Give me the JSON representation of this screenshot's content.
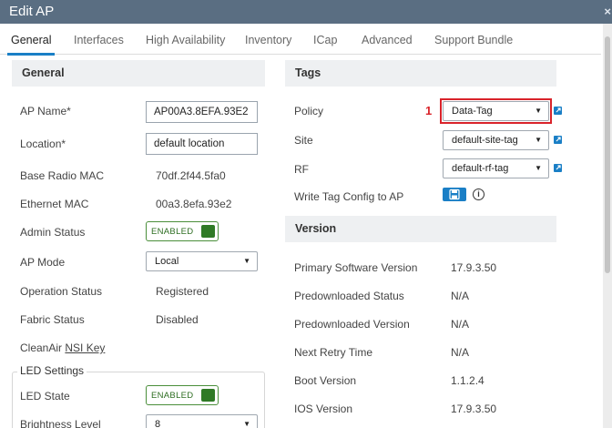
{
  "window": {
    "title": "Edit AP",
    "close_glyph": "×"
  },
  "tabs": [
    {
      "label": "General",
      "active": true
    },
    {
      "label": "Interfaces"
    },
    {
      "label": "High Availability"
    },
    {
      "label": "Inventory"
    },
    {
      "label": "ICap"
    },
    {
      "label": "Advanced"
    },
    {
      "label": "Support Bundle"
    }
  ],
  "general": {
    "heading": "General",
    "ap_name": {
      "label": "AP Name*",
      "value": "AP00A3.8EFA.93E2"
    },
    "location": {
      "label": "Location*",
      "value": "default location"
    },
    "base_radio_mac": {
      "label": "Base Radio MAC",
      "value": "70df.2f44.5fa0"
    },
    "ethernet_mac": {
      "label": "Ethernet MAC",
      "value": "00a3.8efa.93e2"
    },
    "admin_status": {
      "label": "Admin Status",
      "value": "ENABLED"
    },
    "ap_mode": {
      "label": "AP Mode",
      "value": "Local"
    },
    "operation_status": {
      "label": "Operation Status",
      "value": "Registered"
    },
    "fabric_status": {
      "label": "Fabric Status",
      "value": "Disabled"
    },
    "cleanair": {
      "label": "CleanAir",
      "link": "NSI Key"
    }
  },
  "led_settings": {
    "legend": "LED Settings",
    "led_state": {
      "label": "LED State",
      "value": "ENABLED"
    },
    "brightness_level": {
      "label": "Brightness Level",
      "value": "8"
    }
  },
  "tags": {
    "heading": "Tags",
    "policy": {
      "label": "Policy",
      "value": "Data-Tag"
    },
    "site": {
      "label": "Site",
      "value": "default-site-tag"
    },
    "rf": {
      "label": "RF",
      "value": "default-rf-tag"
    },
    "write_tag": {
      "label": "Write Tag Config to AP"
    },
    "callout_number": "1",
    "info_glyph": "i"
  },
  "version": {
    "heading": "Version",
    "rows": [
      {
        "label": "Primary Software Version",
        "value": "17.9.3.50"
      },
      {
        "label": "Predownloaded Status",
        "value": "N/A"
      },
      {
        "label": "Predownloaded Version",
        "value": "N/A"
      },
      {
        "label": "Next Retry Time",
        "value": "N/A"
      },
      {
        "label": "Boot Version",
        "value": "1.1.2.4"
      },
      {
        "label": "IOS Version",
        "value": "17.9.3.50"
      }
    ]
  },
  "icons": {
    "close": "close-icon",
    "dropdown": "caret-down-icon",
    "external": "external-link-icon",
    "save": "save-icon",
    "info": "info-icon"
  },
  "colors": {
    "titlebar": "#5a6e82",
    "active_tab_underline": "#1a7fc6",
    "toggle_green": "#2f7a25",
    "highlight_red": "#d9232a",
    "action_blue": "#1a7fc6"
  }
}
